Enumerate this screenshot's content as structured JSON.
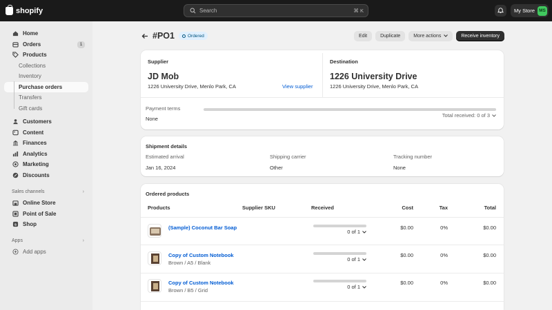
{
  "brand": {
    "name": "shopify"
  },
  "search": {
    "placeholder": "Search",
    "shortcut": "⌘ K"
  },
  "store": {
    "name": "My Store",
    "initials": "MS"
  },
  "sidebar": {
    "items": [
      {
        "label": "Home",
        "icon": "home-icon"
      },
      {
        "label": "Orders",
        "icon": "orders-icon",
        "badge": "1"
      },
      {
        "label": "Products",
        "icon": "tag-icon"
      },
      {
        "label": "Collections"
      },
      {
        "label": "Inventory"
      },
      {
        "label": "Purchase orders"
      },
      {
        "label": "Transfers"
      },
      {
        "label": "Gift cards"
      },
      {
        "label": "Customers",
        "icon": "person-icon"
      },
      {
        "label": "Content",
        "icon": "content-icon"
      },
      {
        "label": "Finances",
        "icon": "bank-icon"
      },
      {
        "label": "Analytics",
        "icon": "chart-icon"
      },
      {
        "label": "Marketing",
        "icon": "target-icon"
      },
      {
        "label": "Discounts",
        "icon": "discount-icon"
      }
    ],
    "sales_channels_label": "Sales channels",
    "channels": [
      {
        "label": "Online Store",
        "icon": "store-icon"
      },
      {
        "label": "Point of Sale",
        "icon": "pos-icon"
      },
      {
        "label": "Shop",
        "icon": "shop-icon"
      }
    ],
    "apps_label": "Apps",
    "add_apps": "Add apps"
  },
  "header": {
    "title": "#PO1",
    "status": "Ordered",
    "edit": "Edit",
    "duplicate": "Duplicate",
    "more_actions": "More actions",
    "receive": "Receive inventory"
  },
  "supplier": {
    "label": "Supplier",
    "name": "JD Mob",
    "address": "1226 University Drive, Menlo Park, CA",
    "view_link": "View supplier"
  },
  "destination": {
    "label": "Destination",
    "name": "1226 University Drive",
    "address": "1226 University Drive, Menlo Park, CA"
  },
  "payment": {
    "label": "Payment terms",
    "value": "None",
    "total_received": "Total received: 0 of 3",
    "received_fraction": 0
  },
  "shipment": {
    "title": "Shipment details",
    "arrival_label": "Estimated arrival",
    "arrival_value": "Jan 16, 2024",
    "carrier_label": "Shipping carrier",
    "carrier_value": "Other",
    "tracking_label": "Tracking number",
    "tracking_value": "None"
  },
  "products": {
    "title": "Ordered products",
    "columns": {
      "products": "Products",
      "sku": "Supplier SKU",
      "received": "Received",
      "cost": "Cost",
      "tax": "Tax",
      "total": "Total"
    },
    "rows": [
      {
        "name": "(Sample) Coconut Bar Soap",
        "variant": "",
        "received": "0 of 1",
        "received_fraction": 0,
        "cost": "$0.00",
        "tax": "0%",
        "total": "$0.00"
      },
      {
        "name": "Copy of Custom Notebook",
        "variant": "Brown / A5 / Blank",
        "received": "0 of 1",
        "received_fraction": 0,
        "cost": "$0.00",
        "tax": "0%",
        "total": "$0.00"
      },
      {
        "name": "Copy of Custom Notebook",
        "variant": "Brown / B5 / Grid",
        "received": "0 of 1",
        "received_fraction": 0,
        "cost": "$0.00",
        "tax": "0%",
        "total": "$0.00"
      }
    ]
  }
}
